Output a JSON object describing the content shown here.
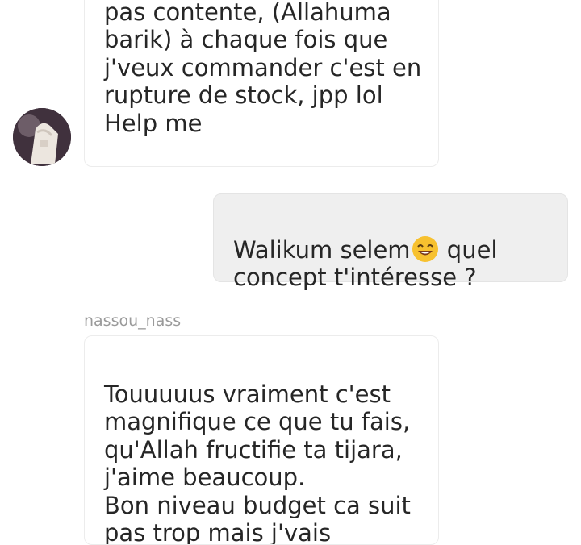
{
  "messages": [
    {
      "direction": "incoming",
      "lines_before_visible": "pas contente, (Allahuma barik) à chaque fois que j'veux commander c'est en rupture de stock, jpp lol Help me",
      "text": "...y\npas contente, (Allahuma\nbarik) à chaque fois que\nj'veux commander c'est en\nrupture de stock, jpp lol\nHelp me"
    },
    {
      "direction": "outgoing",
      "text_before_emoji": "Walikum selem",
      "emoji": "smiling-face-with-smiling-eyes-icon",
      "text_after_emoji": " quel\nconcept t'intéresse ?"
    },
    {
      "direction": "incoming",
      "sender": "nassou_nass",
      "text": "Touuuuus vraiment c'est\nmagnifique ce que tu fais,\nqu'Allah fructifie ta tijara,\nj'aime beaucoup.\nBon niveau budget ca suit\npas trop mais j'vais"
    }
  ],
  "colors": {
    "incoming_bg": "#ffffff",
    "outgoing_bg": "#efefef",
    "text": "#262626",
    "sender_name": "#9a9a9a"
  }
}
